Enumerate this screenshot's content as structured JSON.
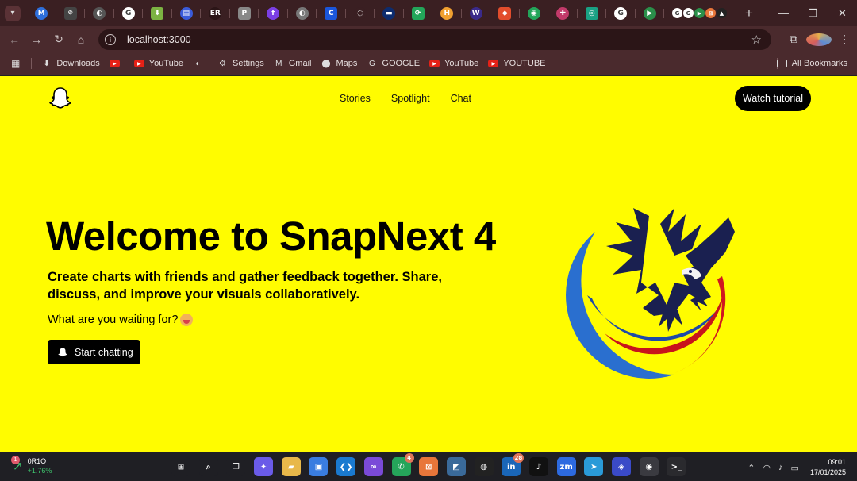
{
  "browser": {
    "tabs": [
      {
        "icon": "medium-icon",
        "glyph": "M",
        "color": "#2e6fdc"
      },
      {
        "icon": "openai-icon",
        "glyph": "⌾",
        "color": "#444"
      },
      {
        "icon": "globe-icon",
        "glyph": "◐",
        "color": "#555"
      },
      {
        "icon": "google-icon",
        "glyph": "G",
        "color": "#ffffff"
      },
      {
        "icon": "download-icon",
        "glyph": "⬇",
        "color": "#7cb342"
      },
      {
        "icon": "printer-icon",
        "glyph": "▤",
        "color": "#3a5bd9"
      },
      {
        "icon": "er-icon",
        "glyph": "ER",
        "color": "#2b1517"
      },
      {
        "icon": "pinterest-icon",
        "glyph": "P",
        "color": "#888"
      },
      {
        "icon": "figma-f-icon",
        "glyph": "f",
        "color": "#7b3fe4"
      },
      {
        "icon": "globe-icon",
        "glyph": "◐",
        "color": "#777"
      },
      {
        "icon": "c-icon",
        "glyph": "C",
        "color": "#1a56db"
      },
      {
        "icon": "loading-icon",
        "glyph": "◌",
        "color": "#3a1f22"
      },
      {
        "icon": "app-icon",
        "glyph": "▬",
        "color": "#0d2c6e"
      },
      {
        "icon": "refresh-green-icon",
        "glyph": "⟳",
        "color": "#23a55a"
      },
      {
        "icon": "h-icon",
        "glyph": "H",
        "color": "#f0a030"
      },
      {
        "icon": "w-icon",
        "glyph": "W",
        "color": "#3a2a8a"
      },
      {
        "icon": "figma-icon",
        "glyph": "◆",
        "color": "#e24d2c"
      },
      {
        "icon": "headset-icon",
        "glyph": "◉",
        "color": "#23a55a"
      },
      {
        "icon": "slack-icon",
        "glyph": "✚",
        "color": "#c23a6a"
      },
      {
        "icon": "swirl-icon",
        "glyph": "◎",
        "color": "#1aa184"
      },
      {
        "icon": "google-icon",
        "glyph": "G",
        "color": "#ffffff"
      },
      {
        "icon": "meet-icon",
        "glyph": "▶",
        "color": "#2a8f4a"
      }
    ],
    "cluster": [
      "G",
      "G",
      "▶",
      "⊠",
      "▲"
    ],
    "new_tab": "+",
    "url": "localhost:3000",
    "bookmarks": [
      {
        "label": "Downloads",
        "icon": "download-icon",
        "glyph": "⬇"
      },
      {
        "label": "",
        "icon": "youtube-icon",
        "glyph": "▶"
      },
      {
        "label": "YouTube",
        "icon": "youtube-icon",
        "glyph": "▶"
      },
      {
        "label": "",
        "icon": "globe-icon",
        "glyph": "◐"
      },
      {
        "label": "Settings",
        "icon": "gear-icon",
        "glyph": "⚙"
      },
      {
        "label": "Gmail",
        "icon": "gmail-icon",
        "glyph": "M"
      },
      {
        "label": "Maps",
        "icon": "maps-icon",
        "glyph": "⬤"
      },
      {
        "label": "GOOGLE",
        "icon": "google-icon",
        "glyph": "G"
      },
      {
        "label": "YouTube",
        "icon": "youtube-icon",
        "glyph": "▶"
      },
      {
        "label": "YOUTUBE",
        "icon": "youtube-icon",
        "glyph": "▶"
      }
    ],
    "all_bookmarks": "All Bookmarks"
  },
  "site": {
    "nav": [
      "Stories",
      "Spotlight",
      "Chat"
    ],
    "watch_button": "Watch tutorial",
    "hero_title": "Welcome to SnapNext 4",
    "hero_subtitle": "Create charts with friends and gather feedback together. Share, discuss, and improve your visuals collaboratively.",
    "hero_question": "What are you waiting for?",
    "start_button": "Start chatting",
    "brand_color": "#fffc00"
  },
  "taskbar": {
    "stock_badge": "1",
    "stock_ticker": "0R1O",
    "stock_change": "+1.76%",
    "apps": [
      {
        "icon": "windows-icon",
        "glyph": "⊞",
        "color": "#1f1f24"
      },
      {
        "icon": "search-icon",
        "glyph": "⌕",
        "color": "#1f1f24"
      },
      {
        "icon": "task-view-icon",
        "glyph": "❐",
        "color": "#1f1f24"
      },
      {
        "icon": "copilot-icon",
        "glyph": "✦",
        "color": "#6a5be8"
      },
      {
        "icon": "file-explorer-icon",
        "glyph": "▰",
        "color": "#e8b84a"
      },
      {
        "icon": "store-icon",
        "glyph": "▣",
        "color": "#3a7de0"
      },
      {
        "icon": "vscode-icon",
        "glyph": "❮❯",
        "color": "#1a7ad0"
      },
      {
        "icon": "visual-studio-icon",
        "glyph": "∞",
        "color": "#7a4ad8"
      },
      {
        "icon": "whatsapp-icon",
        "glyph": "✆",
        "color": "#25a55a",
        "count": "4"
      },
      {
        "icon": "xampp-icon",
        "glyph": "⊠",
        "color": "#e8763a"
      },
      {
        "icon": "mysql-workbench-icon",
        "glyph": "◩",
        "color": "#3a6a9a"
      },
      {
        "icon": "github-icon",
        "glyph": "◍",
        "color": "#222"
      },
      {
        "icon": "linkedin-icon",
        "glyph": "in",
        "color": "#1a66b8",
        "count": "28"
      },
      {
        "icon": "tiktok-icon",
        "glyph": "♪",
        "color": "#111"
      },
      {
        "icon": "zoom-icon",
        "glyph": "zm",
        "color": "#2d6ae0"
      },
      {
        "icon": "telegram-icon",
        "glyph": "➤",
        "color": "#2a9ad8"
      },
      {
        "icon": "app-icon",
        "glyph": "◈",
        "color": "#3a4ac8"
      },
      {
        "icon": "chrome-icon",
        "glyph": "◉",
        "color": "#3a3a40"
      },
      {
        "icon": "terminal-icon",
        "glyph": ">_",
        "color": "#2a2a2e"
      }
    ],
    "time": "09:01",
    "date": "17/01/2025"
  }
}
